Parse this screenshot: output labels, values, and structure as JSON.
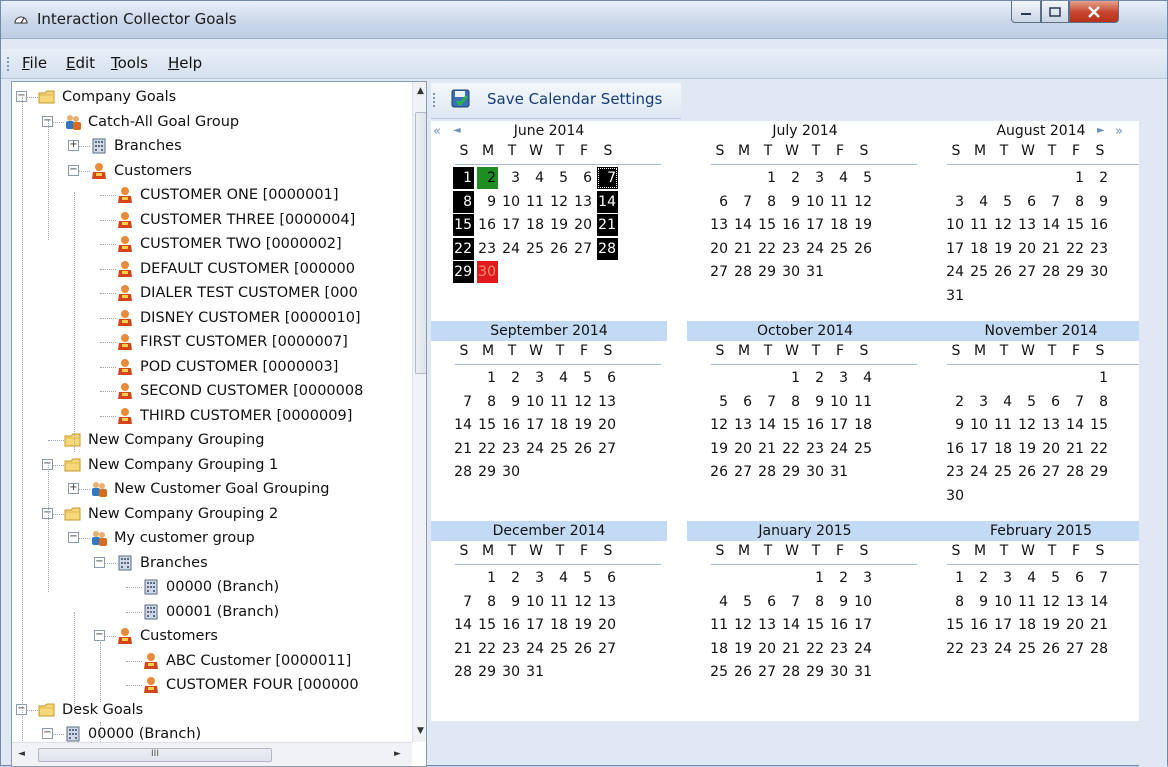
{
  "window": {
    "title": "Interaction Collector Goals"
  },
  "menu": [
    {
      "label": "File",
      "underline": "F"
    },
    {
      "label": "Edit",
      "underline": "E"
    },
    {
      "label": "Tools",
      "underline": "T"
    },
    {
      "label": "Help",
      "underline": "H"
    }
  ],
  "toolbar": {
    "save_label": "Save Calendar Settings"
  },
  "tree": [
    {
      "label": "Company Goals",
      "icon": "folder-icon",
      "expander": "minus"
    },
    {
      "label": "Catch-All Goal Group",
      "icon": "group-icon",
      "expander": "minus"
    },
    {
      "label": "Branches",
      "icon": "building-icon",
      "expander": "plus"
    },
    {
      "label": "Customers",
      "icon": "customer-icon",
      "expander": "minus"
    },
    {
      "label": "CUSTOMER ONE [0000001]",
      "icon": "customer-icon"
    },
    {
      "label": "CUSTOMER THREE [0000004]",
      "icon": "customer-icon"
    },
    {
      "label": "CUSTOMER TWO [0000002]",
      "icon": "customer-icon"
    },
    {
      "label": "DEFAULT CUSTOMER [000000",
      "icon": "customer-icon"
    },
    {
      "label": "DIALER TEST CUSTOMER [000",
      "icon": "customer-icon"
    },
    {
      "label": "DISNEY CUSTOMER [0000010]",
      "icon": "customer-icon"
    },
    {
      "label": "FIRST CUSTOMER [0000007]",
      "icon": "customer-icon"
    },
    {
      "label": "POD CUSTOMER [0000003]",
      "icon": "customer-icon"
    },
    {
      "label": "SECOND CUSTOMER [0000008",
      "icon": "customer-icon"
    },
    {
      "label": "THIRD CUSTOMER [0000009]",
      "icon": "customer-icon"
    },
    {
      "label": "New Company Grouping",
      "icon": "folder-icon"
    },
    {
      "label": "New Company Grouping 1",
      "icon": "folder-icon",
      "expander": "minus"
    },
    {
      "label": "New Customer Goal Grouping",
      "icon": "group-icon",
      "expander": "plus"
    },
    {
      "label": "New Company Grouping 2",
      "icon": "folder-icon",
      "expander": "minus"
    },
    {
      "label": "My customer group",
      "icon": "group-icon",
      "expander": "minus"
    },
    {
      "label": "Branches",
      "icon": "building-icon",
      "expander": "minus"
    },
    {
      "label": "00000 (Branch)",
      "icon": "building-icon"
    },
    {
      "label": "00001 (Branch)",
      "icon": "building-icon"
    },
    {
      "label": "Customers",
      "icon": "customer-icon",
      "expander": "minus"
    },
    {
      "label": "ABC Customer [0000011]",
      "icon": "customer-icon"
    },
    {
      "label": "CUSTOMER FOUR [000000",
      "icon": "customer-icon"
    },
    {
      "label": "Desk Goals",
      "icon": "folder-icon",
      "expander": "minus"
    },
    {
      "label": "00000 (Branch)",
      "icon": "building-icon",
      "expander": "minus"
    }
  ],
  "calendar": {
    "weekday_headers": [
      "S",
      "M",
      "T",
      "W",
      "T",
      "F",
      "S"
    ],
    "months": [
      {
        "title": "June 2014",
        "first_weekday": 0,
        "days": 30
      },
      {
        "title": "July 2014",
        "first_weekday": 2,
        "days": 31
      },
      {
        "title": "August 2014",
        "first_weekday": 5,
        "days": 31
      },
      {
        "title": "September 2014",
        "first_weekday": 1,
        "days": 30
      },
      {
        "title": "October 2014",
        "first_weekday": 3,
        "days": 31
      },
      {
        "title": "November 2014",
        "first_weekday": 6,
        "days": 30
      },
      {
        "title": "December 2014",
        "first_weekday": 1,
        "days": 31
      },
      {
        "title": "January 2015",
        "first_weekday": 4,
        "days": 31
      },
      {
        "title": "February 2015",
        "first_weekday": 0,
        "days": 28
      }
    ],
    "highlighted_june": {
      "black_days": [
        1,
        7,
        8,
        14,
        15,
        21,
        22,
        28,
        29
      ],
      "green_days": [
        2
      ],
      "red_days": [
        30
      ],
      "selected_day": 7
    },
    "nav": {
      "prev_fast": "«",
      "prev": "◄",
      "next": "►",
      "next_fast": "»"
    }
  },
  "scrollbar": {
    "h_thumb_grip": "III"
  }
}
